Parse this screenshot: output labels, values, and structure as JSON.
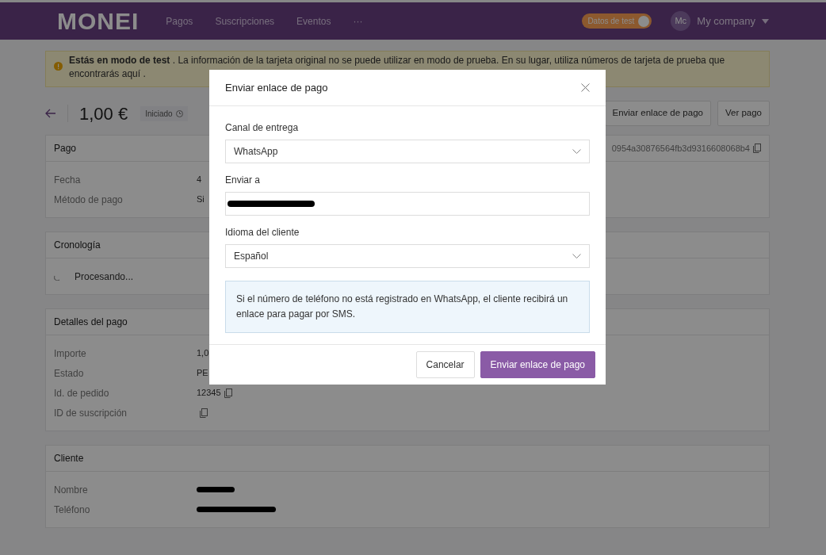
{
  "navbar": {
    "logo": "MONEI",
    "links": [
      {
        "label": "Pagos"
      },
      {
        "label": "Suscripciones"
      },
      {
        "label": "Eventos"
      },
      {
        "label": "···"
      }
    ],
    "test_toggle": {
      "label": "Datos de test",
      "on": true
    },
    "account": {
      "initials": "Mc",
      "name": "My company"
    }
  },
  "alert": {
    "text": "**Estás en modo de test** . La información de la tarjeta original no se puede utilizar en modo de prueba. En su lugar, utiliza números de tarjeta de prueba que encontrarás",
    "link": "aquí",
    "suffix": " ."
  },
  "header": {
    "amount": "1,00 €",
    "status": "Iniciado",
    "buttons": [
      "Enviar enlace de pago",
      "Ver pago"
    ]
  },
  "cards": [
    {
      "title": "Pago",
      "id_text": "0954a30876564fb3d9316608068b4",
      "rows": [
        {
          "label": "Fecha",
          "value": "4"
        },
        {
          "label": "Método de pago",
          "value": "Si"
        }
      ]
    },
    {
      "title": "Cronología",
      "events": [
        {
          "kind": "processing",
          "text": "Procesando..."
        }
      ]
    },
    {
      "title": "Detalles del pago",
      "rows": [
        {
          "label": "Importe",
          "value": "1,0"
        },
        {
          "label": "Estado",
          "value": "PE"
        },
        {
          "label": "Id. de pedido",
          "value": "12345",
          "copy": true
        },
        {
          "label": "ID de suscripción",
          "copy": true
        }
      ]
    },
    {
      "title": "Cliente",
      "rows": [
        {
          "label": "Nombre",
          "redacted": true
        },
        {
          "label": "Teléfono",
          "redacted": true
        }
      ]
    }
  ],
  "modal": {
    "title": "Enviar enlace de pago",
    "fields": [
      {
        "kind": "select",
        "label": "Canal de entrega",
        "value": "WhatsApp"
      },
      {
        "kind": "input",
        "label": "Enviar a",
        "redacted": true
      },
      {
        "kind": "select",
        "label": "Idioma del cliente",
        "value": "Español"
      }
    ],
    "info": "Si el número de teléfono no está registrado en WhatsApp, el cliente recibirá un enlace para pagar por SMS.",
    "buttons": [
      {
        "label": "Cancelar",
        "primary": false
      },
      {
        "label": "Enviar enlace de pago",
        "primary": true
      }
    ]
  }
}
